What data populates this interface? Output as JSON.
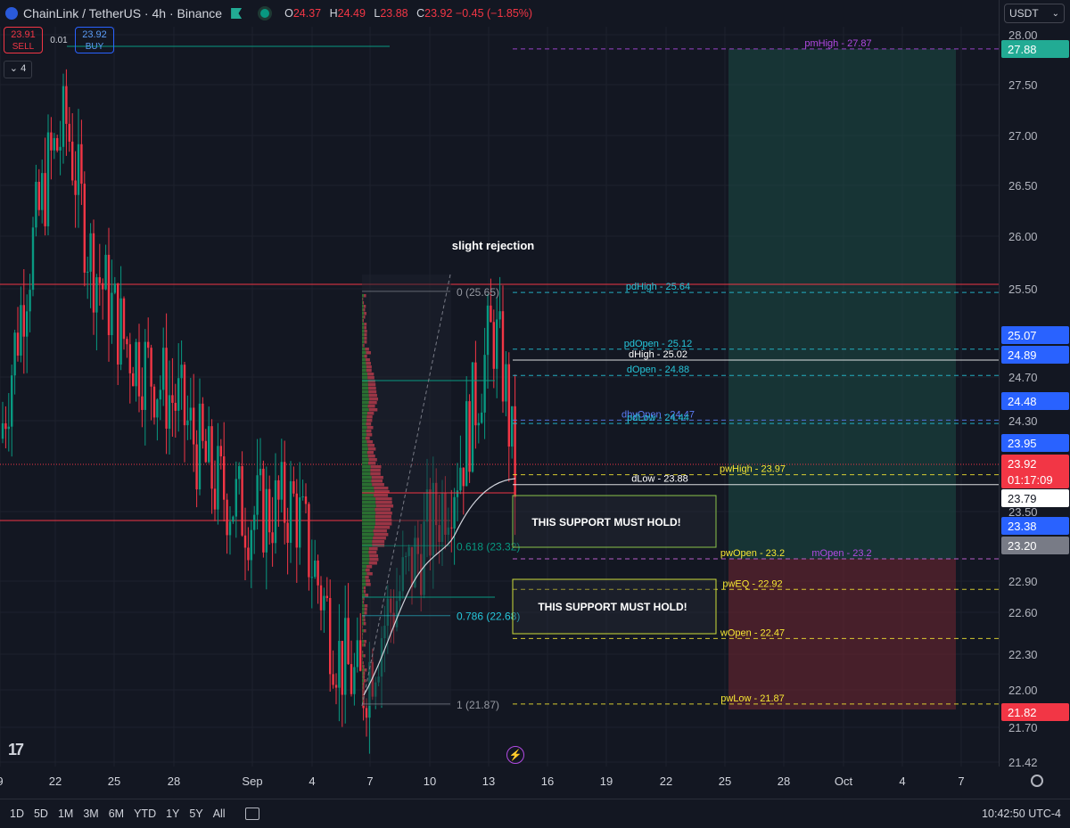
{
  "header": {
    "symbol": "ChainLink / TetherUS · 4h · Binance",
    "ohlc": [
      {
        "k": "O",
        "v": "24.37"
      },
      {
        "k": "H",
        "v": "24.49"
      },
      {
        "k": "L",
        "v": "23.88"
      },
      {
        "k": "C",
        "v": "23.92 −0.45 (−1.85%)"
      }
    ]
  },
  "trade": {
    "sell_price": "23.91",
    "sell_label": "SELL",
    "spread": "0.01",
    "buy_price": "23.92",
    "buy_label": "BUY"
  },
  "collapse_label": "4",
  "currency": "USDT",
  "colors": {
    "up": "#089981",
    "down": "#f23645",
    "background": "#131722"
  },
  "axis": {
    "price_ticks": [
      "28.00",
      "27.50",
      "27.00",
      "26.50",
      "26.00",
      "25.50",
      "24.70",
      "24.30",
      "23.50",
      "22.90",
      "22.60",
      "22.30",
      "22.00",
      "21.70",
      "21.42"
    ],
    "time_labels": [
      "9",
      "22",
      "25",
      "28",
      "Sep",
      "4",
      "7",
      "10",
      "13",
      "16",
      "19",
      "22",
      "25",
      "28",
      "Oct",
      "4",
      "7"
    ]
  },
  "price_badges": [
    {
      "text": "27.88",
      "bg": "#22ab94",
      "fg": "#ffffff"
    },
    {
      "text": "25.07",
      "bg": "#2962ff",
      "fg": "#ffffff"
    },
    {
      "text": "24.89",
      "bg": "#2962ff",
      "fg": "#ffffff"
    },
    {
      "text": "24.48",
      "bg": "#2962ff",
      "fg": "#ffffff"
    },
    {
      "text": "23.95",
      "bg": "#2962ff",
      "fg": "#ffffff"
    },
    {
      "text": "23.79",
      "bg": "#ffffff",
      "fg": "#131722"
    },
    {
      "text": "23.38",
      "bg": "#2962ff",
      "fg": "#ffffff"
    },
    {
      "text": "23.20",
      "bg": "#787b86",
      "fg": "#ffffff"
    },
    {
      "text": "21.82",
      "bg": "#f23645",
      "fg": "#ffffff"
    }
  ],
  "current_price": {
    "price": "23.92",
    "countdown": "01:17:09"
  },
  "levels": [
    {
      "label": "pmHigh - 27.87",
      "price": 27.87,
      "color": "#b24ae3"
    },
    {
      "label": "pdHigh - 25.64",
      "price": 25.64,
      "color": "#26c6da"
    },
    {
      "label": "pdOpen - 25.12",
      "price": 25.12,
      "color": "#26c6da"
    },
    {
      "label": "dHigh - 25.02",
      "price": 25.02,
      "color": "#ffffff"
    },
    {
      "label": "dOpen - 24.88",
      "price": 24.88,
      "color": "#26c6da"
    },
    {
      "label": "dbyOpen - 24.47",
      "price": 24.47,
      "color": "#5b7cf6"
    },
    {
      "label": "pdLow - 24.44",
      "price": 24.44,
      "color": "#26c6da"
    },
    {
      "label": "pwHigh - 23.97",
      "price": 23.97,
      "color": "#f7e733"
    },
    {
      "label": "dLow - 23.88",
      "price": 23.88,
      "color": "#ffffff"
    },
    {
      "label": "pwOpen - 23.2",
      "price": 23.2,
      "color": "#f7e733"
    },
    {
      "label": "mOpen - 23.2",
      "price": 23.2,
      "color": "#b24ae3"
    },
    {
      "label": "pwEQ - 22.92",
      "price": 22.92,
      "color": "#f7e733"
    },
    {
      "label": "wOpen - 22.47",
      "price": 22.47,
      "color": "#f7e733"
    },
    {
      "label": "pwLow - 21.87",
      "price": 21.87,
      "color": "#f7e733"
    }
  ],
  "fib": [
    {
      "label": "0 (25.65)",
      "price": 25.65,
      "color": "#9598a1"
    },
    {
      "label": "0.618 (23.32)",
      "price": 23.32,
      "color": "#089981"
    },
    {
      "label": "0.786 (22.68)",
      "price": 22.68,
      "color": "#26c6da"
    },
    {
      "label": "1 (21.87)",
      "price": 21.87,
      "color": "#9598a1"
    }
  ],
  "annotations": {
    "rejection": "slight rejection",
    "support1": "THIS SUPPORT MUST HOLD!",
    "support2": "THIS SUPPORT MUST HOLD!"
  },
  "bottom": {
    "ranges": [
      "1D",
      "5D",
      "1M",
      "3M",
      "6M",
      "YTD",
      "1Y",
      "5Y",
      "All"
    ],
    "clock": "10:42:50 UTC-4"
  }
}
